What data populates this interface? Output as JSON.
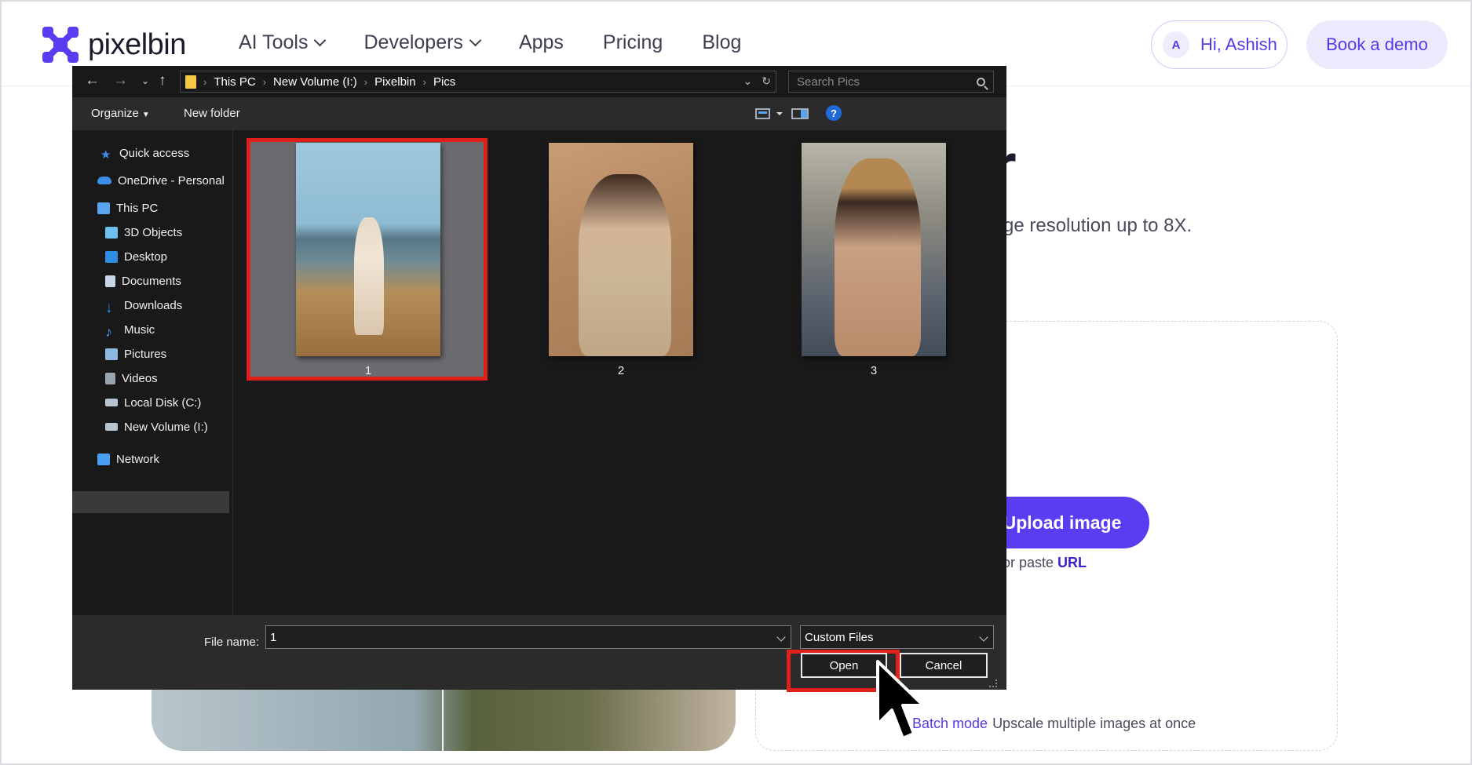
{
  "site": {
    "logo_text": "pixelbin",
    "nav": [
      {
        "label": "AI Tools",
        "dropdown": true
      },
      {
        "label": "Developers",
        "dropdown": true
      },
      {
        "label": "Apps",
        "dropdown": false
      },
      {
        "label": "Pricing",
        "dropdown": false
      },
      {
        "label": "Blog",
        "dropdown": false
      }
    ],
    "user_initial": "A",
    "user_greeting": "Hi, Ashish",
    "demo_label": "Book a demo",
    "hero_title_fragment": "r",
    "hero_subtitle_fragment": "ge resolution up to 8X.",
    "upload_label": "Upload image",
    "paste_prefix": "or paste ",
    "paste_link": "URL",
    "batch_link": "Batch mode",
    "batch_desc": "Upscale multiple images at once",
    "accent_color": "#5b3cf0"
  },
  "dialog": {
    "path": [
      "This PC",
      "New Volume (I:)",
      "Pixelbin",
      "Pics"
    ],
    "search_placeholder": "Search Pics",
    "toolbar": {
      "organize": "Organize",
      "new_folder": "New folder",
      "help": "?"
    },
    "sidebar": [
      {
        "label": "Quick access",
        "icon": "star-icon",
        "color": "#3d8ee8"
      },
      {
        "label": "OneDrive - Personal",
        "icon": "cloud-icon",
        "color": "#3d8ee8"
      },
      {
        "label": "This PC",
        "icon": "computer-icon",
        "color": "#5aa6ee"
      },
      {
        "label": "3D Objects",
        "icon": "cube-icon",
        "color": "#6cc0f0"
      },
      {
        "label": "Desktop",
        "icon": "desktop-icon",
        "color": "#2f8de4"
      },
      {
        "label": "Documents",
        "icon": "document-icon",
        "color": "#c7d6e6"
      },
      {
        "label": "Downloads",
        "icon": "download-icon",
        "color": "#2f8de4"
      },
      {
        "label": "Music",
        "icon": "music-icon",
        "color": "#4aa0f0"
      },
      {
        "label": "Pictures",
        "icon": "pictures-icon",
        "color": "#8cb8e0"
      },
      {
        "label": "Videos",
        "icon": "video-icon",
        "color": "#9aa4b0"
      },
      {
        "label": "Local Disk (C:)",
        "icon": "drive-icon",
        "color": "#b8c4cf"
      },
      {
        "label": "New Volume (I:)",
        "icon": "drive-icon",
        "color": "#b8c4cf",
        "selected": true
      },
      {
        "label": "Network",
        "icon": "network-icon",
        "color": "#4aa0f0"
      }
    ],
    "files": [
      {
        "name": "1",
        "selected": true
      },
      {
        "name": "2",
        "selected": false
      },
      {
        "name": "3",
        "selected": false
      }
    ],
    "file_name_label": "File name:",
    "file_name_value": "1",
    "file_type": "Custom Files",
    "open_label": "Open",
    "cancel_label": "Cancel",
    "highlight_color": "#e0201a"
  }
}
